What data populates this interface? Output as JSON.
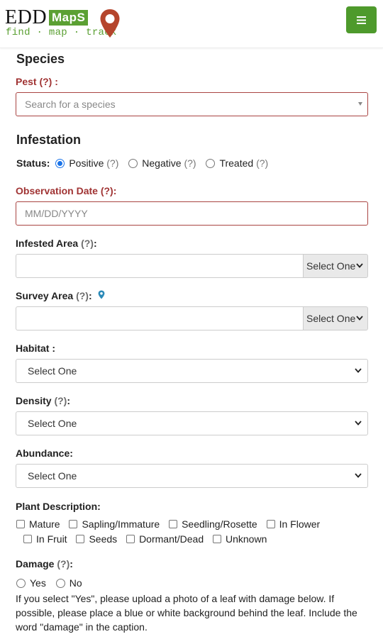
{
  "header": {
    "logo_edd": "EDD",
    "logo_maps": "MapS",
    "logo_tagline": "find · map · track",
    "menu_icon": "hamburger-icon",
    "brand_green": "#4e9a2c",
    "pin_color": "#b5452c"
  },
  "species": {
    "heading": "Species",
    "pest_label": "Pest",
    "pest_help": "(?)",
    "pest_colon": " :",
    "pest_placeholder": "Search for a species"
  },
  "infestation": {
    "heading": "Infestation",
    "status_label": "Status:",
    "status_options": [
      {
        "label": "Positive",
        "help": "(?)",
        "selected": true
      },
      {
        "label": "Negative",
        "help": "(?)",
        "selected": false
      },
      {
        "label": "Treated",
        "help": "(?)",
        "selected": false
      }
    ],
    "obs_date_label": "Observation Date",
    "obs_date_help": "(?)",
    "obs_date_colon": ":",
    "obs_date_placeholder": "MM/DD/YYYY",
    "infested_area_label": "Infested Area",
    "infested_area_help": "(?)",
    "infested_area_colon": ":",
    "infested_area_value": "",
    "infested_area_unit": "Select One",
    "survey_area_label": "Survey Area",
    "survey_area_help": "(?)",
    "survey_area_colon": ":",
    "survey_area_icon": "map-marker-icon",
    "survey_area_value": "",
    "survey_area_unit": "Select One",
    "habitat_label": "Habitat :",
    "habitat_value": "Select One",
    "density_label": "Density",
    "density_help": "(?)",
    "density_colon": ":",
    "density_value": "Select One",
    "abundance_label": "Abundance:",
    "abundance_value": "Select One",
    "plant_desc_label": "Plant Description:",
    "plant_desc_options": [
      "Mature",
      "Sapling/Immature",
      "Seedling/Rosette",
      "In Flower",
      "In Fruit",
      "Seeds",
      "Dormant/Dead",
      "Unknown"
    ],
    "damage_label": "Damage",
    "damage_help": "(?)",
    "damage_colon": ":",
    "damage_options": [
      "Yes",
      "No"
    ],
    "damage_note": "If you select \"Yes\", please upload a photo of a leaf with damage below. If possible, please place a blue or white background behind the leaf. Include the word \"damage\" in the caption."
  }
}
